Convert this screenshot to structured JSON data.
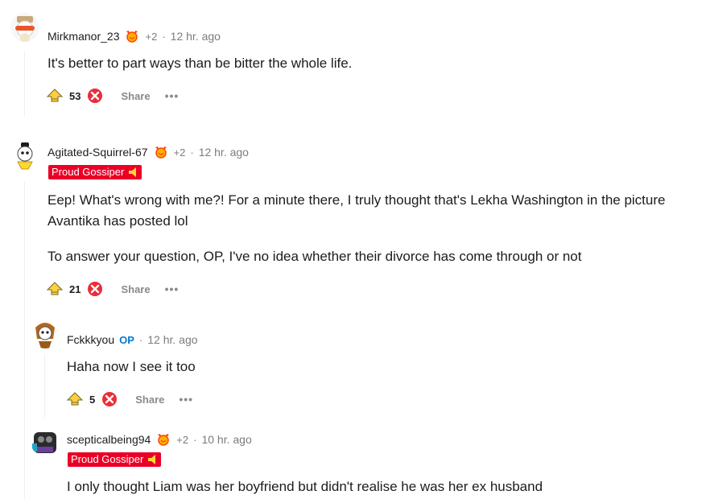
{
  "comments": [
    {
      "username": "Mirkmanor_23",
      "extra": "+2",
      "sep": "·",
      "time": "12 hr. ago",
      "paragraphs": [
        "It's better to part ways than be bitter the whole life."
      ],
      "score": "53",
      "share": "Share",
      "more": "•••"
    },
    {
      "username": "Agitated-Squirrel-67",
      "extra": "+2",
      "sep": "·",
      "time": "12 hr. ago",
      "flair": "Proud Gossiper",
      "paragraphs": [
        "Eep! What's wrong with me?! For a minute there, I truly thought that's Lekha Washington in the picture Avantika has posted lol",
        "To answer your question, OP, I've no idea whether their divorce has come through or not"
      ],
      "score": "21",
      "share": "Share",
      "more": "•••"
    },
    {
      "username": "Fckkkyou",
      "op_badge": "OP",
      "sep": "·",
      "time": "12 hr. ago",
      "paragraphs": [
        "Haha now I see it too"
      ],
      "score": "5",
      "share": "Share",
      "more": "•••"
    },
    {
      "username": "scepticalbeing94",
      "extra": "+2",
      "sep": "·",
      "time": "10 hr. ago",
      "flair": "Proud Gossiper",
      "paragraphs": [
        "I only thought Liam was her boyfriend but didn't realise he was her ex husband"
      ]
    }
  ],
  "colors": {
    "flair_bg": "#ea0027",
    "op": "#0079d3",
    "muted": "#7c7c7c"
  },
  "icons": [
    "upvote-icon",
    "downvote-icon",
    "award-icon",
    "flair-emoji-icon"
  ]
}
